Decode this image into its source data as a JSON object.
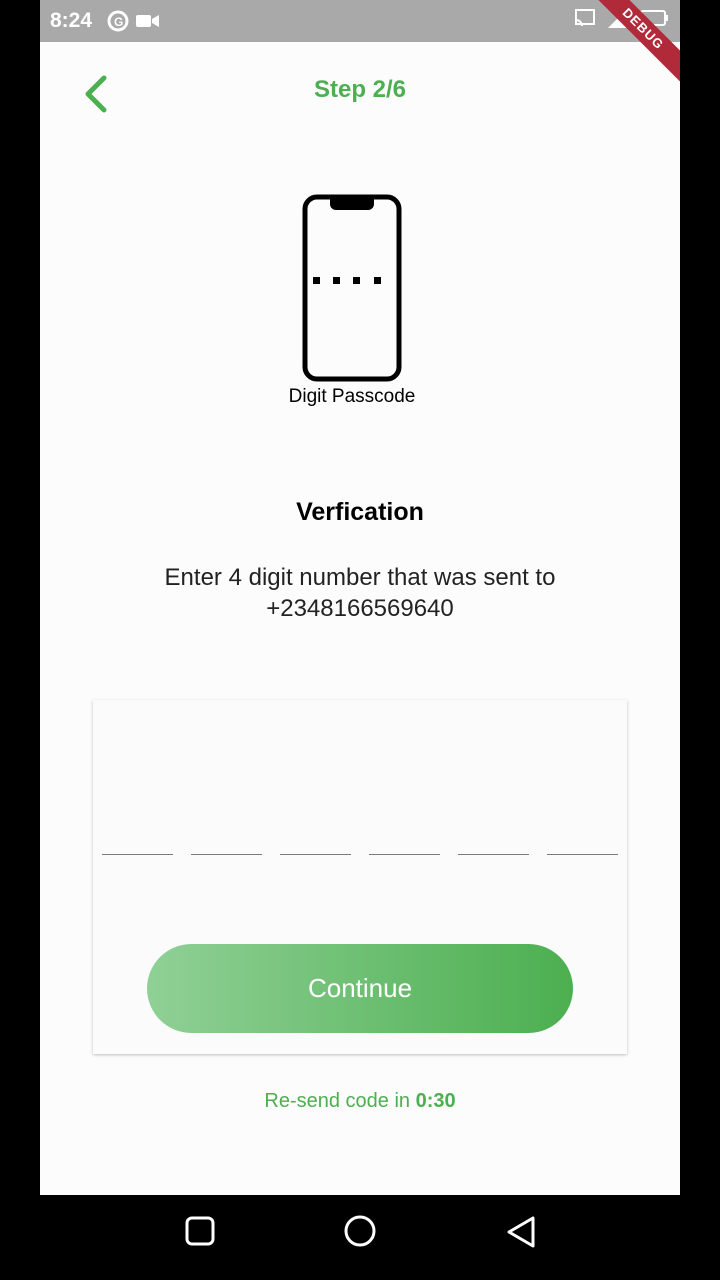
{
  "status_bar": {
    "time": "8:24",
    "debug_label": "DEBUG"
  },
  "header": {
    "title": "Step 2/6",
    "back_icon": "chevron-left-icon"
  },
  "illustration": {
    "caption": "Digit Passcode"
  },
  "verification": {
    "title": "Verfication",
    "description_line1": "Enter 4 digit number that was sent to",
    "phone_number": "+2348166569640"
  },
  "otp": {
    "fields": [
      "",
      "",
      "",
      "",
      "",
      ""
    ]
  },
  "continue_button": {
    "label": "Continue"
  },
  "resend": {
    "prefix": "Re-send code in ",
    "countdown": "0:30"
  },
  "colors": {
    "accent": "#4caf50",
    "gradient_start": "#90d096",
    "gradient_end": "#4caf50"
  }
}
